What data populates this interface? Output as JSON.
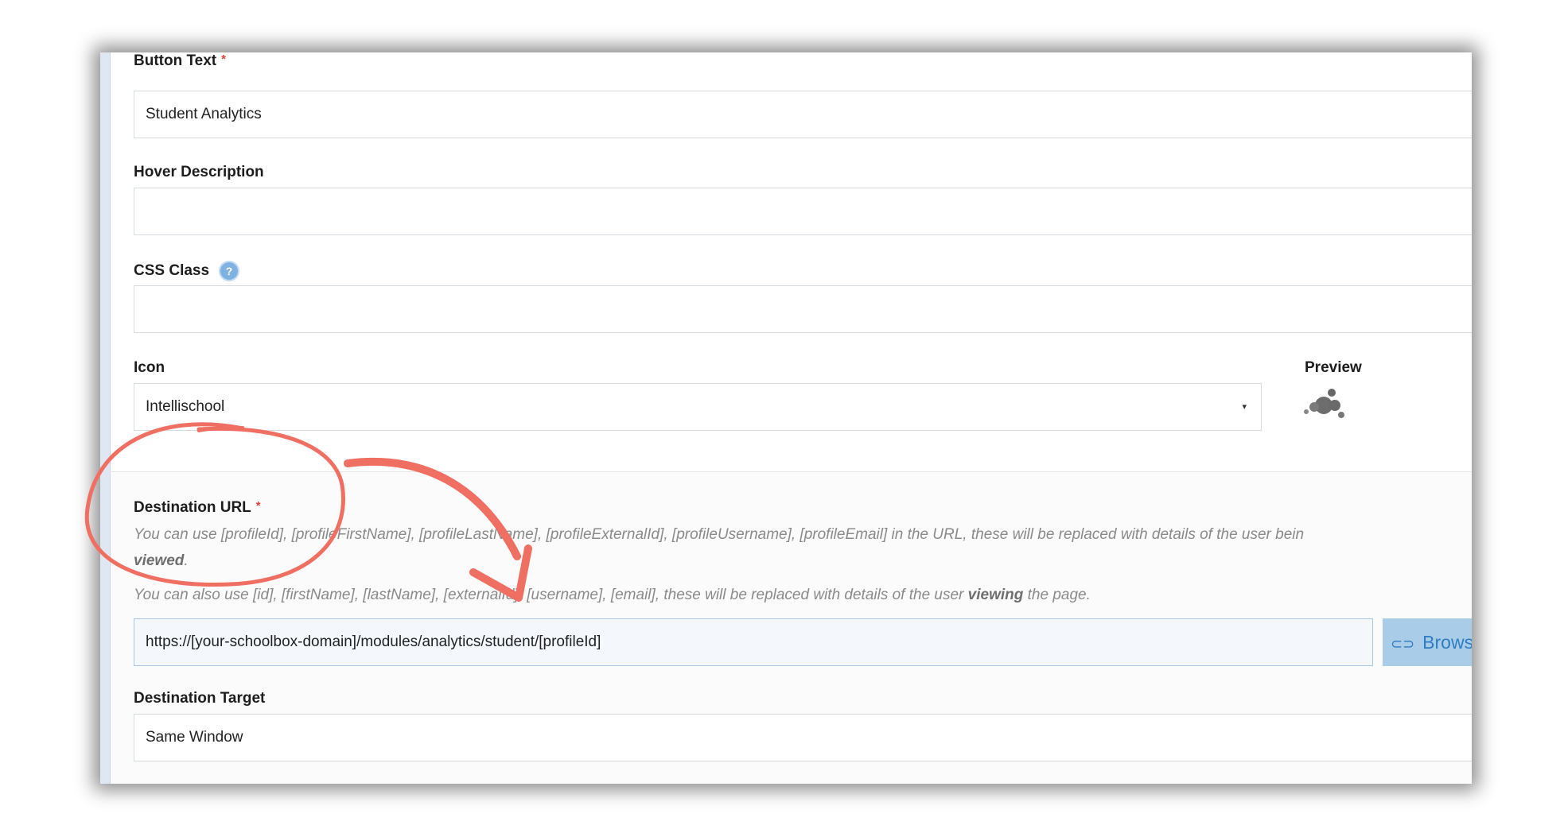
{
  "form": {
    "button_text": {
      "label": "Button Text",
      "required_mark": "*",
      "value": "Student Analytics"
    },
    "hover_description": {
      "label": "Hover Description",
      "value": ""
    },
    "css_class": {
      "label": "CSS Class",
      "help_mark": "?",
      "value": ""
    },
    "icon": {
      "label": "Icon",
      "value": "Intellischool",
      "caret": "▾"
    },
    "preview": {
      "label": "Preview",
      "icon_name": "intellischool-logo-icon"
    },
    "destination_url": {
      "label": "Destination URL",
      "required_mark": "*",
      "help_line_1": "You can use [profileId], [profileFirstName], [profileLastName], [profileExternalId], [profileUsername], [profileEmail] in the URL, these will be replaced with details of the user bein",
      "help_line_2_bold": "viewed",
      "help_line_2_end": ".",
      "help_line_3_start": "You can also use [id], [firstName], [lastName], [externalId], [username], [email], these will be replaced with details of the user",
      "help_line_3_bold": "viewing",
      "help_line_3_end": "the page.",
      "value": "https://[your-schoolbox-domain]/modules/analytics/student/[profileId]",
      "browse_label": "Brows",
      "browse_icon": "link-icon"
    },
    "destination_target": {
      "label": "Destination Target",
      "value": "Same Window"
    }
  },
  "colors": {
    "required": "#e0433a",
    "annotation": "#ef6f62",
    "browse_bg": "#a9cde9",
    "browse_text": "#2f7dc0"
  }
}
